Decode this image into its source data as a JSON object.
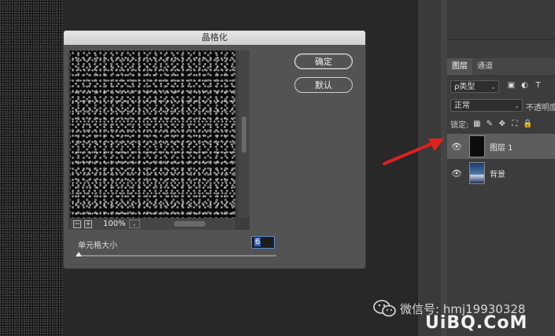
{
  "dialog": {
    "title": "晶格化",
    "ok_label": "确定",
    "default_label": "默认",
    "zoom": "100%",
    "param_label": "单元格大小",
    "param_value": "6",
    "slider_value_fraction": 0.0
  },
  "layers_panel": {
    "tabs": [
      "图层",
      "通道"
    ],
    "filter_kind": "ρ类型",
    "blend_mode": "正常",
    "opacity_label": "不透明度",
    "lock_label": "锁定:",
    "layers": [
      {
        "name": "图层 1",
        "selected": true,
        "thumb": "black"
      },
      {
        "name": "背景",
        "selected": false,
        "thumb": "photo"
      }
    ]
  },
  "overlay": {
    "wechat_text": "微信号: hmj19930328",
    "watermark": "UiBQ.CoM"
  },
  "colors": {
    "arrow": "#e02020",
    "selected_layer": "#5d5d5d",
    "input_focus": "#5a8bd6"
  }
}
